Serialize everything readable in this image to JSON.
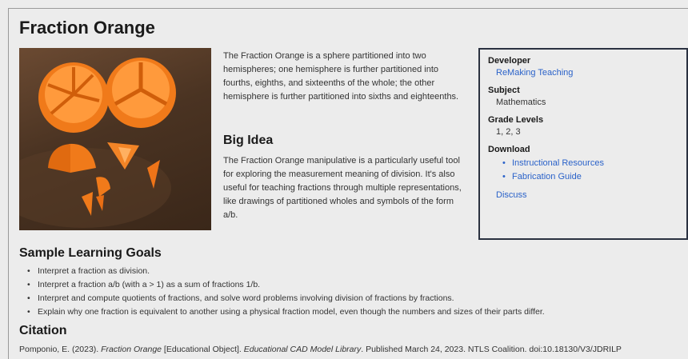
{
  "page": {
    "title": "Fraction Orange"
  },
  "description": "The Fraction Orange is a sphere partitioned into two hemispheres; one hemisphere is further partitioned into fourths, eighths, and sixteenths of the whole; the other hemisphere is further partitioned into sixths and eighteenths.",
  "big_idea": {
    "heading": "Big Idea",
    "text": "The Fraction Orange manipulative is a particularly useful tool for exploring the measurement meaning of division. It's also useful for teaching fractions through multiple representations, like drawings of partitioned wholes and symbols of the form a/b."
  },
  "info": {
    "developer_label": "Developer",
    "developer_value": "ReMaking Teaching",
    "subject_label": "Subject",
    "subject_value": "Mathematics",
    "grade_label": "Grade Levels",
    "grade_value": "1, 2, 3",
    "download_label": "Download",
    "downloads": [
      "Instructional Resources",
      "Fabrication Guide"
    ],
    "discuss_label": "Discuss"
  },
  "goals": {
    "heading": "Sample Learning Goals",
    "items": [
      "Interpret a fraction as division.",
      "Interpret a fraction a/b (with a > 1) as a sum of fractions 1/b.",
      "Interpret and compute quotients of fractions, and solve word problems involving division of fractions by fractions.",
      "Explain why one fraction is equivalent to another using a physical fraction model, even though the numbers and sizes of their parts differ."
    ]
  },
  "citation": {
    "heading": "Citation",
    "author": "Pomponio, E. (2023). ",
    "work_title": "Fraction Orange",
    "type": " [Educational Object]. ",
    "library": "Educational CAD Model Library",
    "rest": ". Published March 24, 2023. NTLS Coalition. doi:10.18130/V3/JDRILP"
  },
  "colors": {
    "link": "#2a62c9",
    "box_border": "#2a3140",
    "orange": "#f07a1a"
  }
}
